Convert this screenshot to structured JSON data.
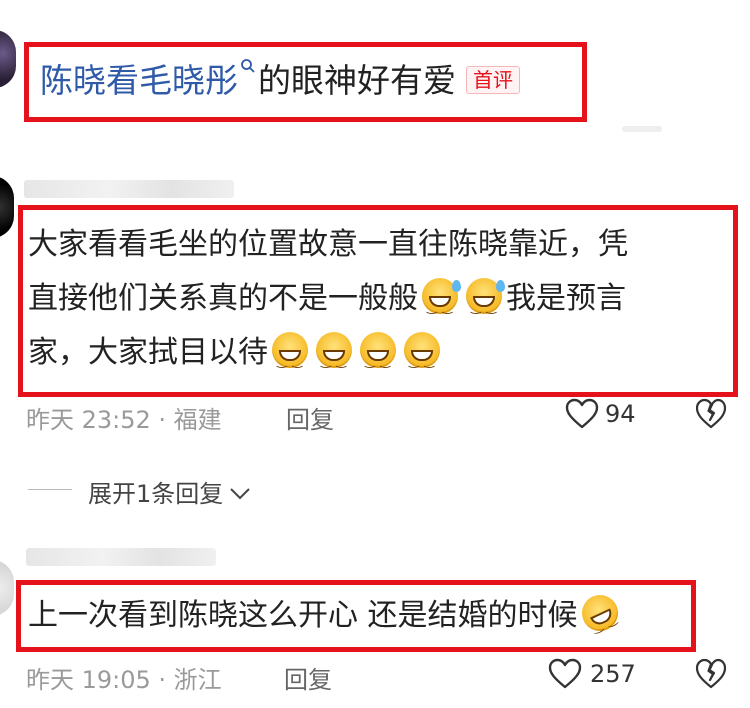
{
  "comments": [
    {
      "text_a": "陈晓看毛晓彤",
      "text_b": "的眼神好有爱",
      "badge": "首评"
    },
    {
      "line1": "大家看看毛坐的位置故意一直往陈晓靠近，凭",
      "line2": "直接他们关系真的不是一般般",
      "line2_tail": "我是预言",
      "line3": "家，大家拭目以待",
      "time": "昨天 23:52 · 福建",
      "reply_label": "回复",
      "like_count": "94",
      "expand_label": "展开1条回复"
    },
    {
      "text": "上一次看到陈晓这么开心 还是结婚的时候",
      "time": "昨天 19:05 · 浙江",
      "reply_label": "回复",
      "like_count": "257"
    }
  ]
}
